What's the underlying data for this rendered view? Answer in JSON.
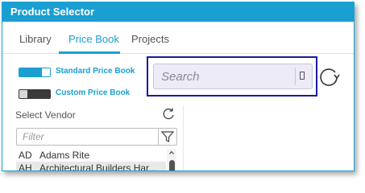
{
  "window": {
    "title": "Product Selector",
    "accent_color": "#1b9fd2",
    "highlight_border_color": "#1a1aa0"
  },
  "tabs": [
    {
      "label": "Library",
      "active": false
    },
    {
      "label": "Price Book",
      "active": true
    },
    {
      "label": "Projects",
      "active": false
    }
  ],
  "price_book_toggles": [
    {
      "label": "Standard Price Book",
      "state": "on"
    },
    {
      "label": "Custom Price Book",
      "state": "off"
    }
  ],
  "search": {
    "placeholder": "Search",
    "value": "",
    "refresh_icon": "refresh-icon"
  },
  "vendor_panel": {
    "label": "Select Vendor",
    "refresh_icon": "refresh-icon",
    "filter": {
      "placeholder": "Filter",
      "value": "",
      "icon": "funnel-icon"
    },
    "vendors": [
      {
        "code": "AD",
        "name": "Adams Rite",
        "selected": false
      },
      {
        "code": "AH",
        "name": "Architectural Builders Har...",
        "selected": true
      }
    ]
  }
}
